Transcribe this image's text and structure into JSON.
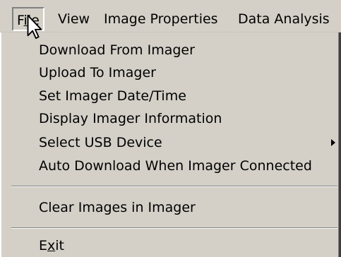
{
  "menubar": {
    "file_pre": "F",
    "file_ul": "i",
    "file_post": "le",
    "view": "View",
    "image_properties": "Image Properties",
    "data_analysis": "Data Analysis"
  },
  "file_menu": {
    "download": "Download From Imager",
    "upload": "Upload To Imager",
    "set_datetime": "Set Imager Date/Time",
    "display_info": "Display Imager Information",
    "select_usb": "Select USB Device",
    "auto_download": "Auto Download When Imager Connected",
    "clear_images": "Clear Images in Imager",
    "exit_pre": "E",
    "exit_ul": "x",
    "exit_post": "it"
  },
  "icons": {
    "cursor": "mouse-pointer-icon",
    "submenu_arrow": "chevron-right-icon"
  }
}
